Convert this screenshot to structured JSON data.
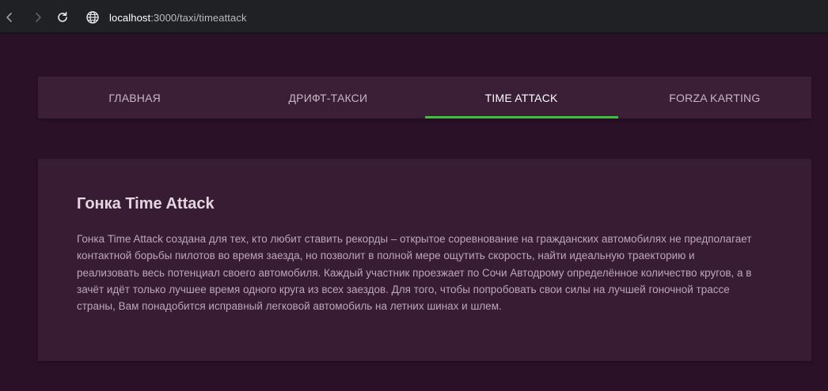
{
  "browser": {
    "url_host": "localhost",
    "url_path": ":3000/taxi/timeattack",
    "back_icon": "chevron-left-icon",
    "forward_icon": "chevron-right-icon",
    "reload_icon": "reload-icon",
    "site_icon": "globe-icon"
  },
  "tabs": [
    {
      "label": "ГЛАВНАЯ",
      "active": false
    },
    {
      "label": "ДРИФТ-ТАКСИ",
      "active": false
    },
    {
      "label": "TIME ATTACK",
      "active": true
    },
    {
      "label": "FORZA KARTING",
      "active": false
    }
  ],
  "card": {
    "title": "Гонка Time Attack",
    "text": "Гонка Time Attack создана для тех, кто любит ставить рекорды – открытое соревнование на гражданских автомобилях не предполагает контактной борьбы пилотов во время заезда, но позволит в полной мере ощутить скорость, найти идеальную траекторию и реализовать весь потенциал своего автомобиля. Каждый участник проезжает по Сочи Автодрому определённое количество кругов, а в зачёт идёт только лучшее время одного круга из всех заездов. Для того, чтобы попробовать свои силы на лучшей гоночной трассе страны, Вам понадобится исправный легковой автомобиль на летних шинах и шлем."
  },
  "colors": {
    "page_background": "#2a1128",
    "tab_bar": "#3a1f36",
    "card": "#371c34",
    "active_underline": "#3fbf3f"
  }
}
